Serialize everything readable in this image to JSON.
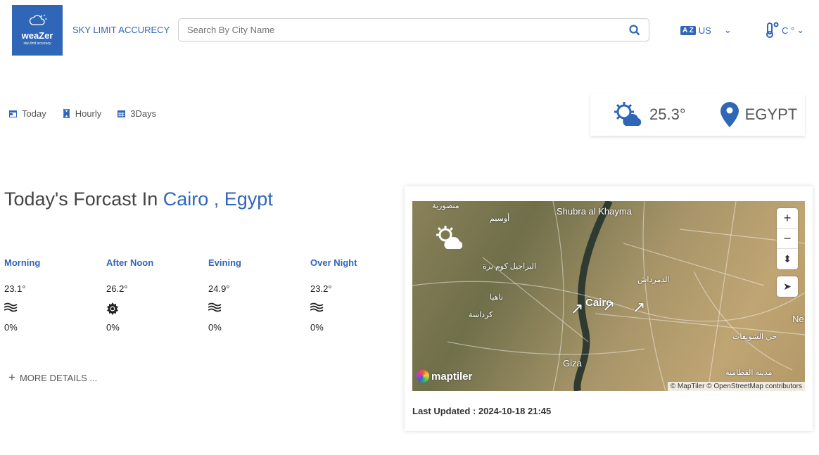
{
  "header": {
    "logo_name": "weaZer",
    "logo_tagline": "sky limit accuracy",
    "brand": "SKY LIMIT ACCURECY",
    "search_placeholder": "Search By City Name",
    "language": "US",
    "unit": "C °"
  },
  "tabs": [
    {
      "label": "Today",
      "icon": "calendar-icon"
    },
    {
      "label": "Hourly",
      "icon": "hourglass-icon"
    },
    {
      "label": "3Days",
      "icon": "calendar-days-icon"
    }
  ],
  "current": {
    "temp": "25.3°",
    "location": "EGYPT"
  },
  "forecast": {
    "title_prefix": "Today's Forcast In ",
    "city": "Cairo , Egypt",
    "periods": [
      {
        "name": "Morning",
        "temp": "23.1°",
        "icon": "fog-icon",
        "precip": "0%"
      },
      {
        "name": "After Noon",
        "temp": "26.2°",
        "icon": "sun-icon",
        "precip": "0%"
      },
      {
        "name": "Evining",
        "temp": "24.9°",
        "icon": "fog-icon",
        "precip": "0%"
      },
      {
        "name": "Over Night",
        "temp": "23.2°",
        "icon": "fog-icon",
        "precip": "0%"
      }
    ],
    "more": "MORE DETAILS ..."
  },
  "map": {
    "labels": [
      "Shubra al Khayma",
      "Cairo",
      "Giza",
      "منصورية",
      "أوسيم",
      "البراجيل كوم برة",
      "ناهيا",
      "كرداسة",
      "الدمرداش",
      "حي الشويفات",
      "مدينة القطامية",
      "Ne"
    ],
    "brand": "maptiler",
    "attribution": "© MapTiler © OpenStreetMap contributors",
    "last_updated": "Last Updated : 2024-10-18 21:45"
  },
  "colors": {
    "accent": "#3066b8"
  }
}
